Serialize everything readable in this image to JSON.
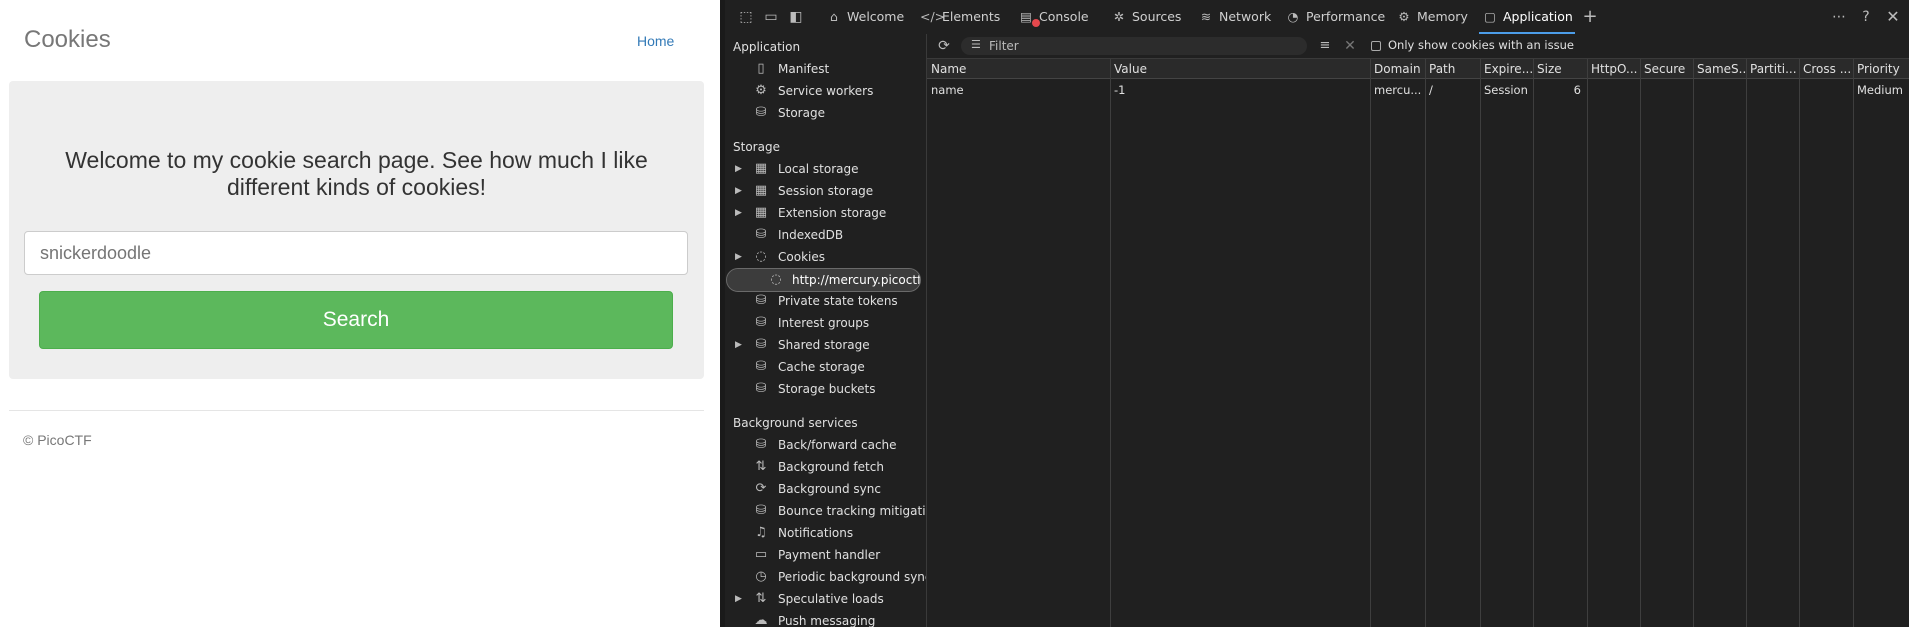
{
  "page": {
    "brand": "Cookies",
    "nav_home": "Home",
    "welcome": "Welcome to my cookie search page. See how much I like different kinds of cookies!",
    "search_placeholder": "snickerdoodle",
    "search_button": "Search",
    "footer": "© PicoCTF"
  },
  "devtools": {
    "tabs": [
      {
        "label": "Welcome",
        "icon": "home-icon"
      },
      {
        "label": "Elements",
        "icon": "code-icon"
      },
      {
        "label": "Console",
        "icon": "console-icon"
      },
      {
        "label": "Sources",
        "icon": "bug-icon"
      },
      {
        "label": "Network",
        "icon": "wifi-icon"
      },
      {
        "label": "Performance",
        "icon": "gauge-icon"
      },
      {
        "label": "Memory",
        "icon": "chip-icon"
      },
      {
        "label": "Application",
        "icon": "app-icon",
        "active": true
      }
    ],
    "sidebar": {
      "sections": [
        {
          "title": "Application"
        },
        {
          "title": "Storage"
        },
        {
          "title": "Background services"
        }
      ],
      "application_items": [
        "Manifest",
        "Service workers",
        "Storage"
      ],
      "storage_items": [
        "Local storage",
        "Session storage",
        "Extension storage",
        "IndexedDB",
        "Cookies",
        "http://mercury.picoctf....",
        "Private state tokens",
        "Interest groups",
        "Shared storage",
        "Cache storage",
        "Storage buckets"
      ],
      "background_items": [
        "Back/forward cache",
        "Background fetch",
        "Background sync",
        "Bounce tracking mitigati...",
        "Notifications",
        "Payment handler",
        "Periodic background sync",
        "Speculative loads",
        "Push messaging"
      ]
    },
    "cookies": {
      "filter_placeholder": "Filter",
      "issue_label": "Only show cookies with an issue",
      "columns": [
        "Name",
        "Value",
        "Domain",
        "Path",
        "Expire...",
        "Size",
        "HttpO...",
        "Secure",
        "SameS...",
        "Partiti...",
        "Cross ...",
        "Priority"
      ],
      "rows": [
        {
          "name": "name",
          "value": "-1",
          "domain": "mercu...",
          "path": "/",
          "expires": "Session",
          "size": "6",
          "priority": "Medium"
        }
      ]
    },
    "colors": {
      "accent": "#4c9de9",
      "background": "#202020",
      "search_green": "#5cb85c",
      "link": "#337ab7"
    }
  }
}
